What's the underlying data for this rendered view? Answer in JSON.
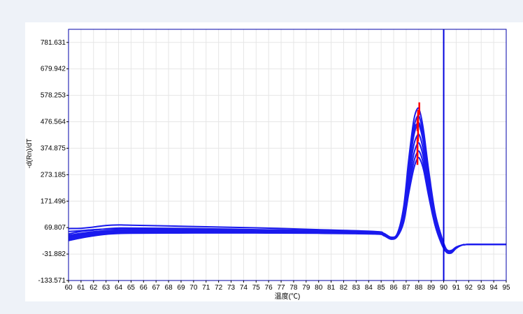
{
  "chart_data": {
    "type": "line",
    "title": "",
    "xlabel": "温度(℃)",
    "ylabel": "-d(Rn)/dT",
    "xlim": [
      60,
      95
    ],
    "ylim": [
      -133.571,
      832.0
    ],
    "x_ticks": [
      60,
      61,
      62,
      63,
      64,
      65,
      66,
      67,
      68,
      69,
      70,
      71,
      72,
      73,
      74,
      75,
      76,
      77,
      78,
      79,
      80,
      81,
      82,
      83,
      84,
      85,
      86,
      87,
      88,
      89,
      90,
      91,
      92,
      93,
      94,
      95
    ],
    "y_ticks": [
      -133.571,
      -31.882,
      69.807,
      171.496,
      273.185,
      374.875,
      476.564,
      578.253,
      679.942,
      781.631
    ],
    "y_tick_labels": [
      "-133.571",
      "-31.882",
      "69.807",
      "171.496",
      "273.185",
      "374.875",
      "476.564",
      "578.253",
      "679.942",
      "781.631"
    ],
    "grid": true,
    "threshold_line": {
      "x": 90.0,
      "color": "#0000dd"
    },
    "series_color": "#1a1aee",
    "peak_marker_color": "#ff0000",
    "series": [
      {
        "x": [
          60,
          61,
          62,
          63,
          64,
          65,
          70,
          75,
          80,
          84.5,
          85.2,
          85.8,
          86.3,
          86.8,
          87.2,
          87.6,
          87.9,
          88.1,
          88.4,
          88.8,
          89.3,
          89.8,
          90.2,
          90.6,
          91.0,
          91.5,
          92,
          93,
          95
        ],
        "y": [
          66,
          67,
          72,
          78,
          80,
          79,
          74,
          69,
          62,
          55,
          48,
          33,
          48,
          150,
          330,
          480,
          527,
          515,
          440,
          290,
          130,
          40,
          -12,
          -18,
          -5,
          3,
          5,
          5,
          5
        ]
      },
      {
        "x": [
          60,
          61,
          62,
          63,
          64,
          65,
          70,
          75,
          80,
          84.5,
          85.2,
          85.8,
          86.3,
          86.8,
          87.2,
          87.6,
          87.9,
          88.1,
          88.4,
          88.8,
          89.3,
          89.8,
          90.2,
          90.6,
          91.0,
          91.5,
          92,
          93,
          95
        ],
        "y": [
          45,
          55,
          60,
          65,
          68,
          68,
          66,
          62,
          58,
          52,
          46,
          32,
          46,
          140,
          310,
          450,
          498,
          488,
          420,
          275,
          120,
          35,
          -15,
          -20,
          -6,
          3,
          5,
          5,
          5
        ]
      },
      {
        "x": [
          60,
          61,
          62,
          63,
          64,
          65,
          70,
          75,
          80,
          84.5,
          85.2,
          85.8,
          86.3,
          86.8,
          87.2,
          87.6,
          87.9,
          88.1,
          88.4,
          88.8,
          89.3,
          89.8,
          90.2,
          90.6,
          91.0,
          91.5,
          92,
          93,
          95
        ],
        "y": [
          40,
          48,
          54,
          58,
          60,
          60,
          59,
          57,
          55,
          50,
          45,
          30,
          44,
          130,
          290,
          420,
          465,
          455,
          390,
          255,
          110,
          30,
          -16,
          -20,
          -6,
          3,
          5,
          5,
          5
        ]
      },
      {
        "x": [
          60,
          61,
          62,
          63,
          64,
          65,
          70,
          75,
          80,
          84.5,
          85.2,
          85.8,
          86.3,
          86.8,
          87.2,
          87.6,
          87.9,
          88.1,
          88.4,
          88.8,
          89.3,
          89.8,
          90.2,
          90.6,
          91.0,
          91.5,
          92,
          93,
          95
        ],
        "y": [
          35,
          44,
          50,
          54,
          56,
          56,
          56,
          54,
          52,
          48,
          43,
          28,
          42,
          120,
          265,
          385,
          425,
          420,
          360,
          235,
          100,
          25,
          -18,
          -22,
          -8,
          3,
          5,
          5,
          5
        ]
      },
      {
        "x": [
          60,
          61,
          62,
          63,
          64,
          65,
          70,
          75,
          80,
          84.5,
          85.2,
          85.8,
          86.3,
          86.8,
          87.2,
          87.6,
          87.9,
          88.1,
          88.4,
          88.8,
          89.3,
          89.8,
          90.2,
          90.6,
          91.0,
          91.5,
          92,
          93,
          95
        ],
        "y": [
          30,
          40,
          46,
          50,
          52,
          53,
          53,
          52,
          50,
          47,
          41,
          27,
          40,
          110,
          240,
          350,
          392,
          388,
          335,
          220,
          95,
          20,
          -20,
          -24,
          -8,
          3,
          5,
          5,
          5
        ]
      },
      {
        "x": [
          60,
          61,
          62,
          63,
          64,
          65,
          70,
          75,
          80,
          84.5,
          85.2,
          85.8,
          86.3,
          86.8,
          87.2,
          87.6,
          87.9,
          88.1,
          88.4,
          88.8,
          89.3,
          89.8,
          90.2,
          90.6,
          91.0,
          91.5,
          92,
          93,
          95
        ],
        "y": [
          25,
          35,
          42,
          47,
          50,
          50,
          51,
          50,
          49,
          46,
          40,
          26,
          38,
          100,
          220,
          320,
          360,
          358,
          310,
          205,
          88,
          15,
          -22,
          -26,
          -9,
          3,
          5,
          5,
          5
        ]
      },
      {
        "x": [
          60,
          61,
          62,
          63,
          64,
          65,
          70,
          75,
          80,
          84.5,
          85.2,
          85.8,
          86.3,
          86.8,
          87.2,
          87.6,
          87.9,
          88.1,
          88.4,
          88.8,
          89.3,
          89.8,
          90.2,
          90.6,
          91.0,
          91.5,
          92,
          93,
          95
        ],
        "y": [
          20,
          30,
          38,
          44,
          47,
          48,
          49,
          49,
          48,
          45,
          39,
          25,
          36,
          90,
          200,
          295,
          335,
          333,
          290,
          190,
          80,
          10,
          -24,
          -28,
          -10,
          3,
          5,
          5,
          5
        ]
      },
      {
        "x": [
          60,
          61,
          62,
          63,
          64,
          65,
          70,
          75,
          80,
          84.5,
          85.2,
          85.8,
          86.3,
          86.8,
          87.2,
          87.6,
          87.9,
          88.1,
          88.4,
          88.8,
          89.3,
          89.8,
          90.2,
          90.6,
          91.0,
          91.5,
          92,
          93,
          95
        ],
        "y": [
          55,
          58,
          62,
          64,
          65,
          65,
          63,
          60,
          57,
          53,
          47,
          30,
          45,
          135,
          300,
          440,
          470,
          465,
          400,
          262,
          112,
          30,
          -14,
          -19,
          -6,
          3,
          5,
          5,
          5
        ]
      }
    ],
    "peak_markers": [
      {
        "x": 88.05,
        "y": 527
      },
      {
        "x": 87.95,
        "y": 498
      },
      {
        "x": 87.9,
        "y": 465
      },
      {
        "x": 87.95,
        "y": 425
      },
      {
        "x": 87.9,
        "y": 392
      },
      {
        "x": 87.9,
        "y": 360
      },
      {
        "x": 87.9,
        "y": 335
      },
      {
        "x": 87.95,
        "y": 470
      }
    ]
  }
}
